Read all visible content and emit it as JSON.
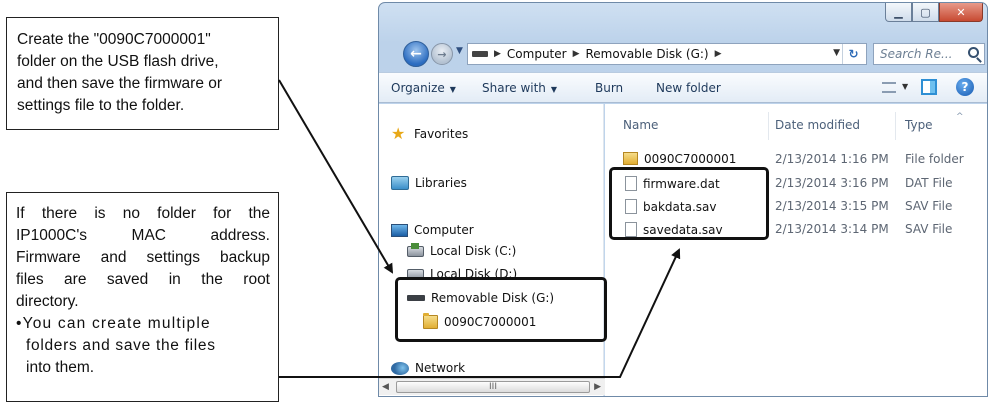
{
  "callouts": {
    "top_lines": [
      "Create the \"0090C7000001\"",
      "folder on the USB flash drive,",
      "and then save the firmware or",
      "settings file to the folder."
    ],
    "bottom_lines": [
      "If there is no folder for the",
      "IP1000C's MAC address.",
      "Firmware and settings backup",
      "files are saved in the root",
      "directory."
    ],
    "bullet": "•You can create multiple",
    "bullet_cont": [
      "folders and save the files",
      "into them."
    ]
  },
  "window": {
    "breadcrumb": [
      "Computer",
      "Removable Disk (G:)"
    ],
    "search_placeholder": "Search Re...",
    "toolbar": {
      "organize": "Organize",
      "share_with": "Share with",
      "burn": "Burn",
      "new_folder": "New folder"
    },
    "nav": {
      "favorites": "Favorites",
      "libraries": "Libraries",
      "computer": "Computer",
      "local_c": "Local Disk (C:)",
      "local_d": "Local Disk (D:)",
      "removable": "Removable Disk (G:)",
      "subfolder": "0090C7000001",
      "network": "Network"
    },
    "scroll_thumb": "III",
    "columns": {
      "name": "Name",
      "date": "Date modified",
      "type": "Type"
    },
    "files": [
      {
        "name": "0090C7000001",
        "date": "2/13/2014 1:16 PM",
        "type": "File folder",
        "kind": "folder"
      },
      {
        "name": "firmware.dat",
        "date": "2/13/2014 3:16 PM",
        "type": "DAT File",
        "kind": "file"
      },
      {
        "name": "bakdata.sav",
        "date": "2/13/2014 3:15 PM",
        "type": "SAV File",
        "kind": "file"
      },
      {
        "name": "savedata.sav",
        "date": "2/13/2014 3:14 PM",
        "type": "SAV File",
        "kind": "file"
      }
    ]
  }
}
